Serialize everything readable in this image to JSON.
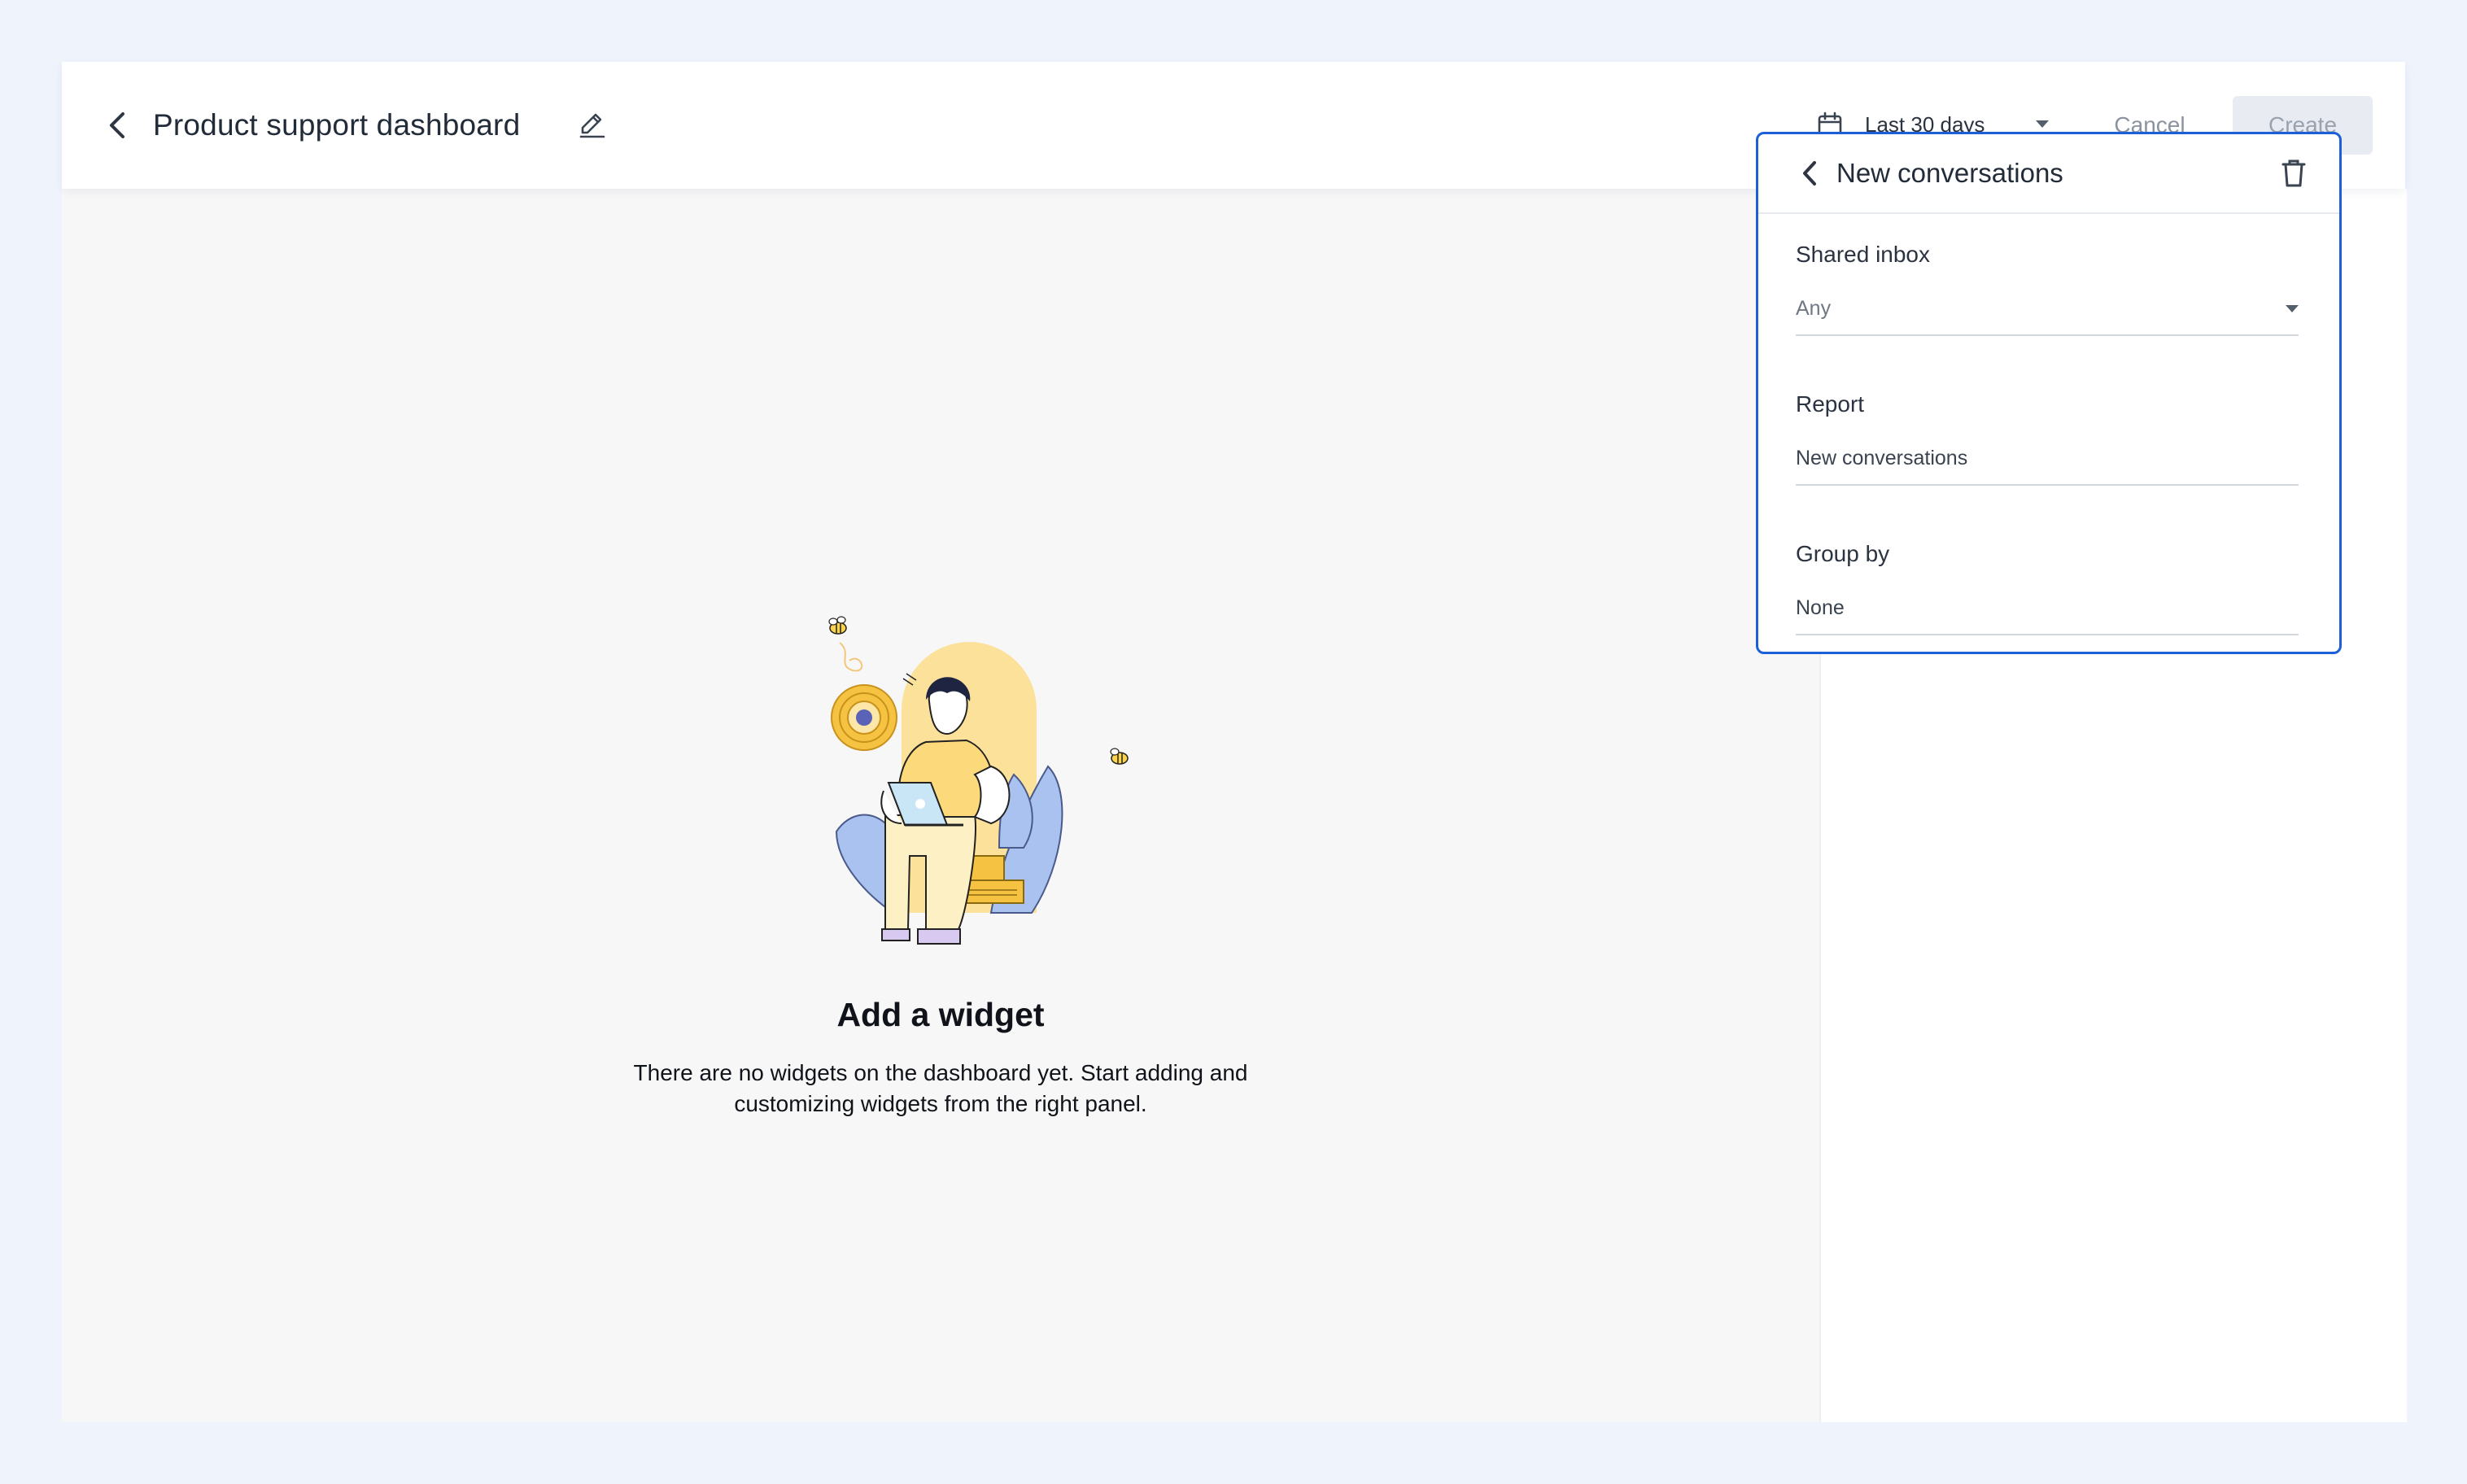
{
  "header": {
    "title": "Product support dashboard",
    "date_range": "Last 30 days",
    "cancel_label": "Cancel",
    "create_label": "Create",
    "icons": [
      "chevron-left-icon",
      "pencil-icon",
      "calendar-icon",
      "caret-down-icon"
    ]
  },
  "empty_state": {
    "title": "Add a widget",
    "description": "There are no widgets on the dashboard yet. Start adding and customizing widgets from the right panel.",
    "illustration": "person-with-laptop-illustration"
  },
  "panel": {
    "title": "New conversations",
    "fields": [
      {
        "label": "Shared inbox",
        "value": "Any",
        "type": "select"
      },
      {
        "label": "Report",
        "value": "New conversations",
        "type": "text"
      },
      {
        "label": "Group by",
        "value": "None",
        "type": "text"
      }
    ],
    "icons": [
      "chevron-left-icon",
      "trash-icon"
    ]
  },
  "colors": {
    "page_background": "#eef3fc",
    "canvas_background": "#f7f7f7",
    "accent": "#1c5fd6",
    "text_primary": "#222b38",
    "disabled_button_bg": "#e8ebf1",
    "illustration_yellow": "#fcd97a",
    "illustration_blue": "#a9c2ef"
  }
}
